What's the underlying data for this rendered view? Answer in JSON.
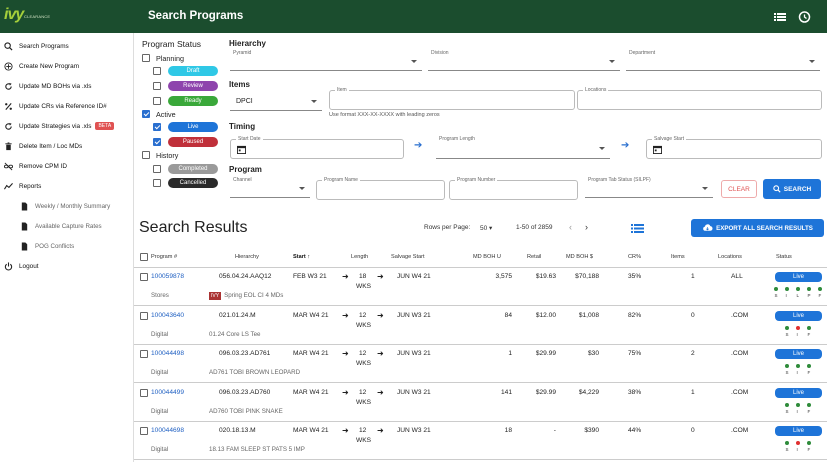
{
  "app": {
    "title": "Search Programs",
    "logo": "ivy",
    "logo_sub": "CLEARANCE"
  },
  "sidebar": {
    "items": [
      {
        "label": "Search Programs",
        "icon": "search-icon"
      },
      {
        "label": "Create New Program",
        "icon": "plus-circle-icon"
      },
      {
        "label": "Update MD BOHs via .xls",
        "icon": "refresh-icon"
      },
      {
        "label": "Update CRs via Reference ID#",
        "icon": "percent-icon"
      },
      {
        "label": "Update Strategies via .xls",
        "icon": "refresh-icon",
        "badge": "BETA"
      },
      {
        "label": "Delete Item / Loc MDs",
        "icon": "trash-icon"
      },
      {
        "label": "Remove CPM ID",
        "icon": "link-off-icon"
      },
      {
        "label": "Reports",
        "icon": "chart-line-icon"
      },
      {
        "label": "Weekly / Monthly Summary",
        "icon": "document-icon"
      },
      {
        "label": "Available Capture Rates",
        "icon": "document-icon"
      },
      {
        "label": "POG Conflicts",
        "icon": "document-icon"
      },
      {
        "label": "Logout",
        "icon": "power-icon"
      }
    ]
  },
  "filters": {
    "status_title": "Program Status",
    "planning": "Planning",
    "active": "Active",
    "history": "History",
    "chips": {
      "draft": "Draft",
      "review": "Review",
      "ready": "Ready",
      "live": "Live",
      "paused": "Paused",
      "completed": "Completed",
      "cancelled": "Cancelled"
    },
    "hierarchy_title": "Hierarchy",
    "pyramid": "Pyramid",
    "division": "Division",
    "department": "Department",
    "items_title": "Items",
    "item_type": "DPCI",
    "item_label": "Item",
    "locations_label": "Locations",
    "item_hint": "Use format XXX-XX-XXXX with leading zeros",
    "timing_title": "Timing",
    "start_date": "Start Date",
    "program_length": "Program Length",
    "salvage_start": "Salvage Start",
    "program_title": "Program",
    "channel": "Channel",
    "program_name": "Program Name",
    "program_number": "Program Number",
    "tab_status": "Program Tab Status (SILPF)",
    "clear": "CLEAR",
    "search": "SEARCH"
  },
  "results": {
    "title": "Search Results",
    "rows_per_page_label": "Rows per Page:",
    "rows_per_page": "50",
    "range": "1-50 of 2859",
    "export": "EXPORT ALL SEARCH RESULTS",
    "columns": [
      "Program #",
      "Hierarchy",
      "Start",
      "Length",
      "Salvage Start",
      "MD BOH U",
      "Retail",
      "MD BOH $",
      "CR%",
      "Items",
      "Locations",
      "Status"
    ],
    "rows": [
      {
        "program": "100059878",
        "hierarchy": "056.04.24.AAQ12",
        "start": "FEB W3 21",
        "length": "18",
        "wks": "WKS",
        "salvage": "JUN W4 21",
        "boh_u": "3,575",
        "retail": "$19.63",
        "boh_d": "$70,188",
        "cr": "35%",
        "items": "1",
        "locations": "ALL",
        "status": "Live",
        "channel": "Stores",
        "desc": "Spring EOL CI 4 MDs",
        "badge": "IVY",
        "dots": [
          "#2e8b3a",
          "#2e8b3a",
          "#2e8b3a",
          "#2e8b3a",
          "#2e8b3a"
        ],
        "dot_labels": [
          "S",
          "I",
          "L",
          "P",
          "F"
        ]
      },
      {
        "program": "100043640",
        "hierarchy": "021.01.24.M",
        "start": "MAR W4 21",
        "length": "12",
        "wks": "WKS",
        "salvage": "JUN W3 21",
        "boh_u": "84",
        "retail": "$12.00",
        "boh_d": "$1,008",
        "cr": "82%",
        "items": "0",
        "locations": ".COM",
        "status": "Live",
        "channel": "Digital",
        "desc": "01.24 Core LS Tee",
        "badge": "",
        "dots": [
          "#2e8b3a",
          "#e03030",
          "#2e8b3a"
        ],
        "dot_labels": [
          "S",
          "I",
          "F"
        ]
      },
      {
        "program": "100044498",
        "hierarchy": "096.03.23.AD761",
        "start": "MAR W4 21",
        "length": "12",
        "wks": "WKS",
        "salvage": "JUN W3 21",
        "boh_u": "1",
        "retail": "$29.99",
        "boh_d": "$30",
        "cr": "75%",
        "items": "2",
        "locations": ".COM",
        "status": "Live",
        "channel": "Digital",
        "desc": "AD761 TOBI BROWN LEOPARD",
        "badge": "",
        "dots": [
          "#2e8b3a",
          "#2e8b3a",
          "#2e8b3a"
        ],
        "dot_labels": [
          "S",
          "I",
          "F"
        ]
      },
      {
        "program": "100044499",
        "hierarchy": "096.03.23.AD760",
        "start": "MAR W4 21",
        "length": "12",
        "wks": "WKS",
        "salvage": "JUN W3 21",
        "boh_u": "141",
        "retail": "$29.99",
        "boh_d": "$4,229",
        "cr": "38%",
        "items": "1",
        "locations": ".COM",
        "status": "Live",
        "channel": "Digital",
        "desc": "AD760 TOBI PINK SNAKE",
        "badge": "",
        "dots": [
          "#2e8b3a",
          "#2e8b3a",
          "#2e8b3a"
        ],
        "dot_labels": [
          "S",
          "I",
          "F"
        ]
      },
      {
        "program": "100044698",
        "hierarchy": "020.18.13.M",
        "start": "MAR W4 21",
        "length": "12",
        "wks": "WKS",
        "salvage": "JUN W3 21",
        "boh_u": "18",
        "retail": "-",
        "boh_d": "$390",
        "cr": "44%",
        "items": "0",
        "locations": ".COM",
        "status": "Live",
        "channel": "Digital",
        "desc": "18.13 FAM SLEEP ST PATS 5 IMP",
        "badge": "",
        "dots": [
          "#2e8b3a",
          "#e03030",
          "#2e8b3a"
        ],
        "dot_labels": [
          "S",
          "I",
          "F"
        ]
      }
    ]
  },
  "colors": {
    "header": "#1b4d2e",
    "primary": "#1e74d8",
    "draft": "#2fc8e6",
    "review": "#8e44ad",
    "ready": "#3aa83a",
    "live": "#1e74d8",
    "paused": "#c0303a",
    "completed": "#9a9a9a",
    "cancelled": "#2a2a2a"
  }
}
